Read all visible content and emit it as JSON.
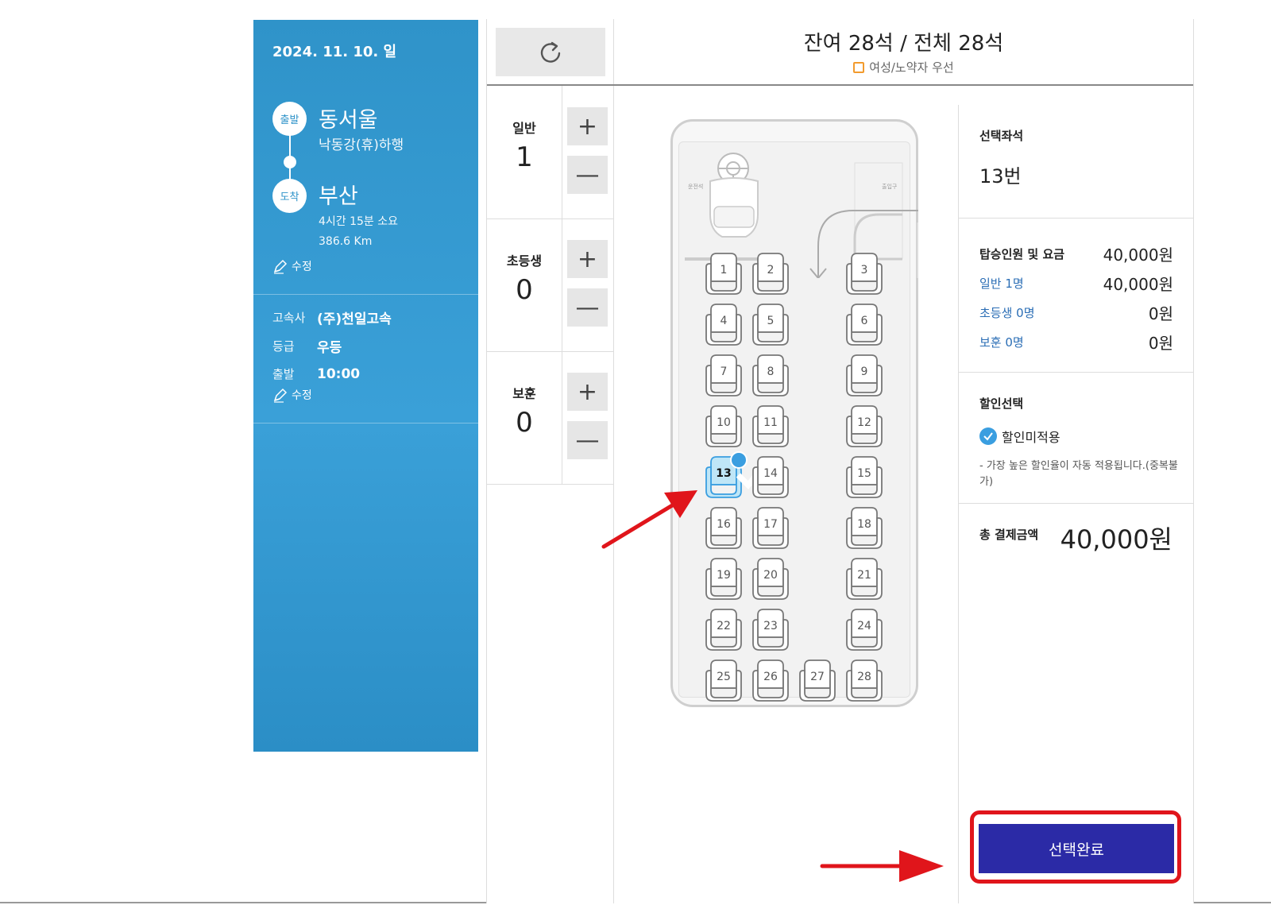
{
  "trip": {
    "date": "2024. 11. 10. 일",
    "departure_badge": "출발",
    "departure": "동서울",
    "via": "낙동강(휴)하행",
    "arrival_badge": "도착",
    "arrival": "부산",
    "duration": "4시간 15분 소요",
    "distance": "386.6 Km",
    "edit_label": "수정"
  },
  "bus_info": {
    "company_label": "고속사",
    "company": "(주)천일고속",
    "grade_label": "등급",
    "grade": "우등",
    "depart_label": "출발",
    "depart_time": "10:00",
    "edit_label": "수정"
  },
  "seat_header": {
    "title": "잔여 28석 / 전체 28석",
    "legend": "여성/노약자 우선"
  },
  "counters": [
    {
      "label": "일반",
      "value": "1"
    },
    {
      "label": "초등생",
      "value": "0"
    },
    {
      "label": "보훈",
      "value": "0"
    }
  ],
  "icons": {
    "refresh": "refresh-icon",
    "plus": "+",
    "minus": "—",
    "check": "check-icon",
    "edit": "pencil-icon"
  },
  "bus_labels": {
    "driver": "운전석",
    "door": "출입구"
  },
  "seats": {
    "selected": 13,
    "rows": [
      [
        1,
        2,
        null,
        3
      ],
      [
        4,
        5,
        null,
        6
      ],
      [
        7,
        8,
        null,
        9
      ],
      [
        10,
        11,
        null,
        12
      ],
      [
        13,
        14,
        null,
        15
      ],
      [
        16,
        17,
        null,
        18
      ],
      [
        19,
        20,
        null,
        21
      ],
      [
        22,
        23,
        null,
        24
      ],
      [
        25,
        26,
        27,
        28
      ]
    ]
  },
  "summary": {
    "selected_seat_label": "선택좌석",
    "selected_seat": "13번",
    "fare_label": "탑승인원 및 요금",
    "fare_total": "40,000원",
    "fares": [
      {
        "label": "일반 1명",
        "value": "40,000원"
      },
      {
        "label": "초등생 0명",
        "value": "0원"
      },
      {
        "label": "보훈 0명",
        "value": "0원"
      }
    ],
    "discount_label": "할인선택",
    "discount_option": "할인미적용",
    "discount_note": "- 가장 높은 할인율이 자동 적용됩니다.(중복불가)",
    "total_label": "총 결제금액",
    "total": "40,000원",
    "confirm": "선택완료"
  },
  "colors": {
    "panel_blue": "#3aa0d8",
    "confirm_bg": "#2b2aa6",
    "highlight_red": "#e0151b",
    "selected_seat": "#3a9ee0",
    "legend_orange": "#f29b2e"
  }
}
